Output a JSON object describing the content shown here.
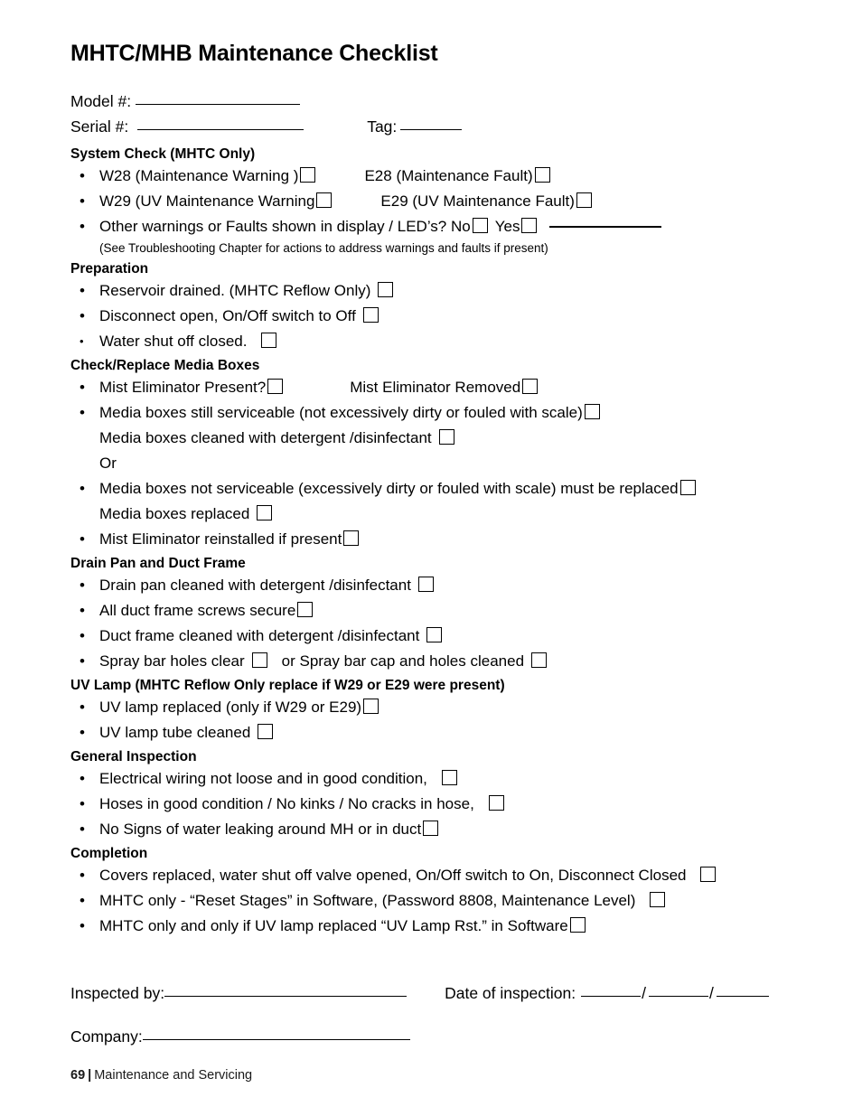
{
  "document": {
    "title": "MHTC/MHB Maintenance Checklist"
  },
  "identification": {
    "model_label": "Model #:",
    "serial_label": "Serial #:",
    "tag_label": "Tag:",
    "model_value": "",
    "serial_value": "",
    "tag_value": ""
  },
  "sections": {
    "system_check": {
      "heading": "System Check (MHTC Only)",
      "items": {
        "w28": "W28 (Maintenance Warning )",
        "e28": "E28 (Maintenance Fault)",
        "w29": "W29 (UV Maintenance Warning",
        "e29": "E29 (UV Maintenance Fault)",
        "other": "Other warnings or Faults shown in display / LED’s? No",
        "other_yes": "Yes",
        "other_value": ""
      },
      "note": "(See Troubleshooting Chapter for actions to address warnings and faults if present)"
    },
    "preparation": {
      "heading": "Preparation",
      "items": {
        "reservoir": "Reservoir drained. (MHTC Reflow Only)",
        "disconnect": "Disconnect open, On/Off switch to Off",
        "water": "Water shut off closed."
      }
    },
    "media_boxes": {
      "heading": "Check/Replace Media Boxes",
      "items": {
        "mist_present": "Mist Eliminator Present?",
        "mist_removed": "Mist Eliminator Removed",
        "serviceable": "Media boxes still serviceable (not excessively dirty or fouled with scale)",
        "cleaned": "Media boxes cleaned with detergent /disinfectant",
        "or": "Or",
        "not_serviceable": "Media boxes not serviceable (excessively dirty or fouled with scale) must be replaced",
        "replaced": "Media boxes replaced",
        "mist_reinstalled": "Mist Eliminator reinstalled if present"
      }
    },
    "drain_pan": {
      "heading": "Drain Pan and Duct Frame",
      "items": {
        "drain_pan_cleaned": "Drain pan cleaned with detergent /disinfectant",
        "screws_secure": "All duct frame screws secure",
        "duct_cleaned": "Duct frame cleaned with detergent /disinfectant",
        "spray_clear": "Spray bar holes clear",
        "spray_cap": "or Spray bar cap and holes cleaned"
      }
    },
    "uv_lamp": {
      "heading": "UV Lamp (MHTC Reflow Only replace if W29 or E29 were present)",
      "items": {
        "lamp_replaced": "UV lamp replaced (only if W29 or E29)",
        "tube_cleaned": "UV lamp tube cleaned"
      }
    },
    "general_inspection": {
      "heading": "General Inspection",
      "items": {
        "wiring": "Electrical wiring not loose and in good condition,",
        "hoses": "Hoses in good condition / No kinks / No cracks in hose,",
        "leaks": "No Signs of water leaking around MH or in duct"
      }
    },
    "completion": {
      "heading": "Completion",
      "items": {
        "covers": "Covers replaced, water shut off valve opened, On/Off switch to On, Disconnect Closed",
        "reset_stages": "MHTC only - “Reset Stages” in Software,  (Password 8808, Maintenance Level)",
        "lamp_reset": "MHTC only and only if UV lamp replaced “UV Lamp Rst.” in Software"
      }
    }
  },
  "signature": {
    "inspected_by_label": "Inspected by:",
    "inspected_by_value": "",
    "date_label": "Date of inspection:",
    "date_day": "",
    "date_month": "",
    "date_year": "",
    "company_label": "Company:",
    "company_value": ""
  },
  "footer": {
    "page_number": "69",
    "separator": "|",
    "chapter": "Maintenance and Servicing"
  }
}
